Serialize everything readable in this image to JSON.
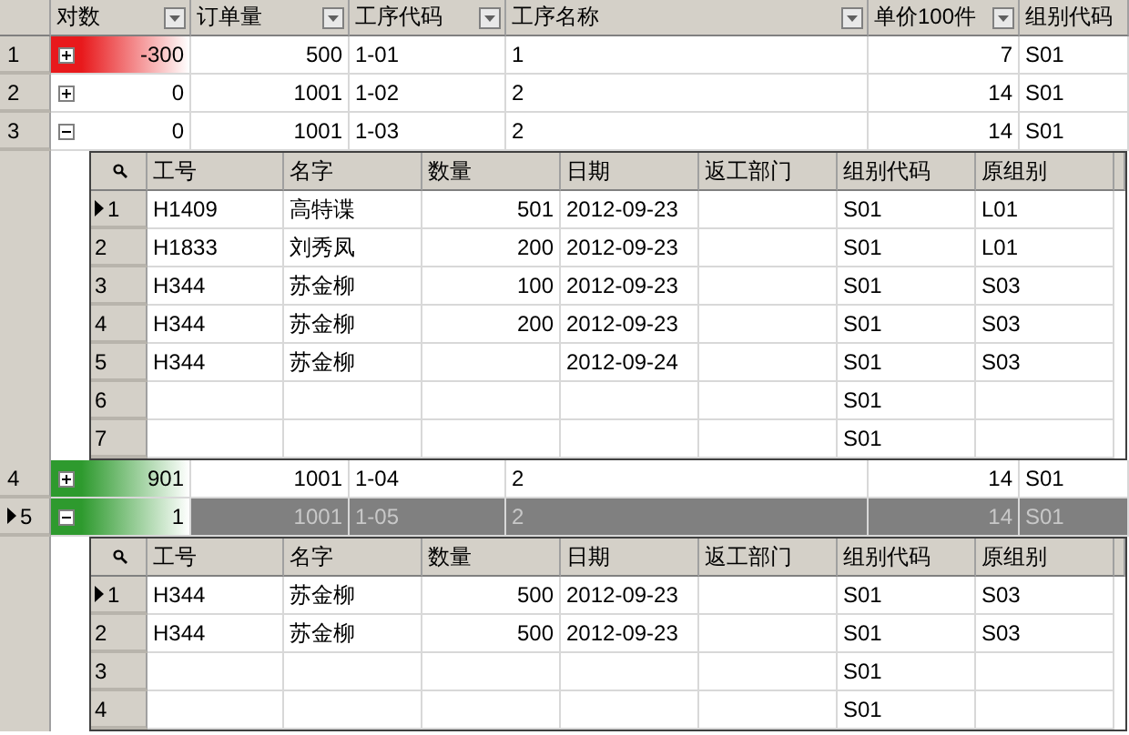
{
  "columns": [
    {
      "label": "对数",
      "filter_button": true
    },
    {
      "label": "订单量",
      "filter_button": true
    },
    {
      "label": "工序代码",
      "filter_button": true
    },
    {
      "label": "工序名称",
      "filter_button": true
    },
    {
      "label": "单价100件",
      "filter_button": true
    },
    {
      "label": "组别代码",
      "filter_button": false
    }
  ],
  "rows": [
    {
      "number": "1",
      "selected": false,
      "expanded": false,
      "color": "#e8191c",
      "cells": [
        "-300",
        "500",
        "1-01",
        "1",
        "7",
        "S01"
      ]
    },
    {
      "number": "2",
      "selected": false,
      "expanded": false,
      "cells": [
        "0",
        "1001",
        "1-02",
        "2",
        "14",
        "S01"
      ]
    },
    {
      "number": "3",
      "selected": false,
      "expanded": true,
      "cells": [
        "0",
        "1001",
        "1-03",
        "2",
        "14",
        "S01"
      ],
      "detail_columns": [
        "工号",
        "名字",
        "数量",
        "日期",
        "返工部门",
        "组别代码",
        "原组别"
      ],
      "children": [
        {
          "number": "1",
          "selected": true,
          "cells": [
            "H1409",
            "高特谍",
            "501",
            "2012-09-23",
            null,
            "S01",
            "L01"
          ]
        },
        {
          "number": "2",
          "selected": false,
          "cells": [
            "H1833",
            "刘秀凤",
            "200",
            "2012-09-23",
            null,
            "S01",
            "L01"
          ]
        },
        {
          "number": "3",
          "selected": false,
          "cells": [
            "H344",
            "苏金柳",
            "100",
            "2012-09-23",
            null,
            "S01",
            "S03"
          ]
        },
        {
          "number": "4",
          "selected": false,
          "cells": [
            "H344",
            "苏金柳",
            "200",
            "2012-09-23",
            null,
            "S01",
            "S03"
          ]
        },
        {
          "number": "5",
          "selected": false,
          "cells": [
            "H344",
            "苏金柳",
            null,
            "2012-09-24",
            null,
            "S01",
            "S03"
          ]
        },
        {
          "number": "6",
          "selected": false,
          "cells": [
            null,
            null,
            null,
            null,
            null,
            "S01",
            null
          ]
        },
        {
          "number": "7",
          "selected": false,
          "cells": [
            null,
            null,
            null,
            null,
            null,
            "S01",
            null
          ]
        }
      ]
    },
    {
      "number": "4",
      "selected": false,
      "expanded": false,
      "color": "#2e9a2e",
      "cells": [
        "901",
        "1001",
        "1-04",
        "2",
        "14",
        "S01"
      ]
    },
    {
      "number": "5",
      "selected": true,
      "expanded": true,
      "color": "#2e9a2e",
      "cells": [
        "1",
        "1001",
        "1-05",
        "2",
        "14",
        "S01"
      ],
      "detail_columns": [
        "工号",
        "名字",
        "数量",
        "日期",
        "返工部门",
        "组别代码",
        "原组别"
      ],
      "children": [
        {
          "number": "1",
          "selected": true,
          "cells": [
            "H344",
            "苏金柳",
            "500",
            "2012-09-23",
            null,
            "S01",
            "S03"
          ]
        },
        {
          "number": "2",
          "selected": false,
          "cells": [
            "H344",
            "苏金柳",
            "500",
            "2012-09-23",
            null,
            "S01",
            "S03"
          ]
        },
        {
          "number": "3",
          "selected": false,
          "cells": [
            null,
            null,
            null,
            null,
            null,
            "S01",
            null
          ]
        },
        {
          "number": "4",
          "selected": false,
          "cells": [
            null,
            null,
            null,
            null,
            null,
            "S01",
            null
          ]
        }
      ]
    }
  ]
}
